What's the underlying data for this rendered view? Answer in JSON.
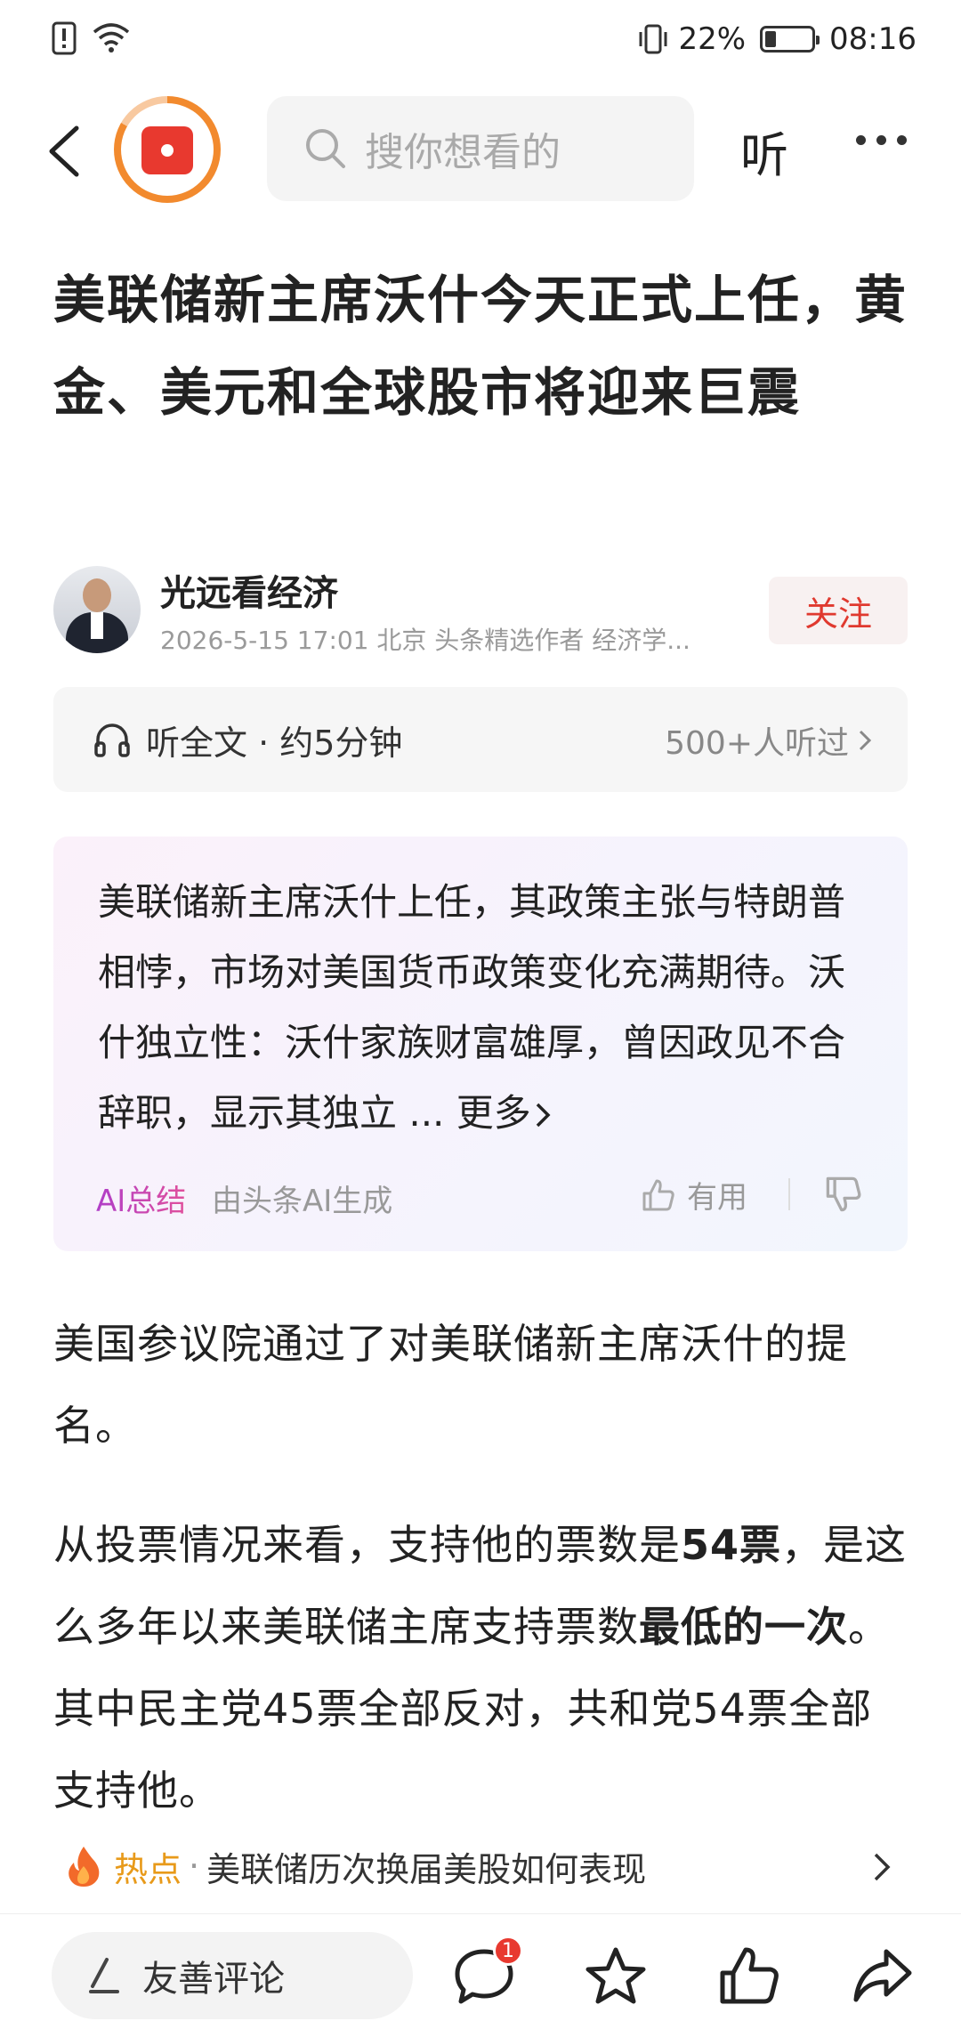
{
  "status_bar": {
    "battery": "22%",
    "battery_level": 0.22,
    "time": "08:16"
  },
  "nav": {
    "search_placeholder": "搜你想看的",
    "listen_label": "听"
  },
  "article": {
    "title": "美联储新主席沃什今天正式上任，黄金、美元和全球股市将迎来巨震",
    "author": {
      "name": "光远看经济",
      "meta": "2026-5-15   17:01   北京   头条精选作者 经济学...",
      "follow_label": "关注"
    },
    "listen": {
      "label": "听全文 · 约5分钟",
      "count": "500+人听过"
    },
    "ai_summary": {
      "text": "美联储新主席沃什上任，其政策主张与特朗普相悖，市场对美国货币政策变化充满期待。沃什独立性：沃什家族财富雄厚，曾因政见不合辞职，显示其独立 ... ",
      "more_label": "更多",
      "label": "AI总结",
      "by": "由头条AI生成",
      "useful_label": "有用"
    },
    "para1": "美国参议院通过了对美联储新主席沃什的提名。",
    "para2": {
      "p1": "从投票情况来看，支持他的票数是",
      "b1": "54票",
      "p2": "，是这么多年以来美联储主席支持票数",
      "b2": "最低的一次",
      "p3": "。其中民主党45票全部反对，共和党54票全部支持他。"
    },
    "hot": {
      "label": "热点",
      "text": "美联储历次换届美股如何表现"
    }
  },
  "bottom_bar": {
    "comment_placeholder": "友善评论",
    "comment_badge": "1"
  }
}
